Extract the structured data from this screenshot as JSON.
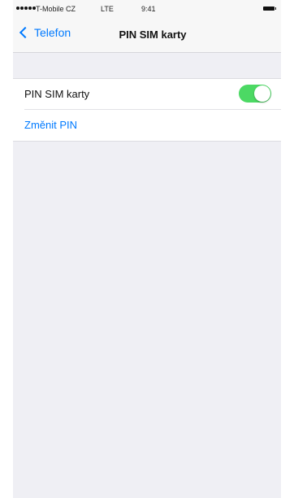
{
  "status_bar": {
    "carrier": "T-Mobile CZ",
    "network": "LTE",
    "time": "9:41",
    "signal_icon": "signal-dots-icon",
    "battery_icon": "battery-icon"
  },
  "nav": {
    "back_label": "Telefon",
    "title": "PIN SIM karty",
    "back_icon": "chevron-left-icon"
  },
  "settings": {
    "pin_toggle_label": "PIN SIM karty",
    "pin_toggle_on": true,
    "change_pin_label": "Změnit PIN"
  },
  "colors": {
    "accent": "#007aff",
    "toggle_on": "#4cd964",
    "background": "#efeff4"
  }
}
